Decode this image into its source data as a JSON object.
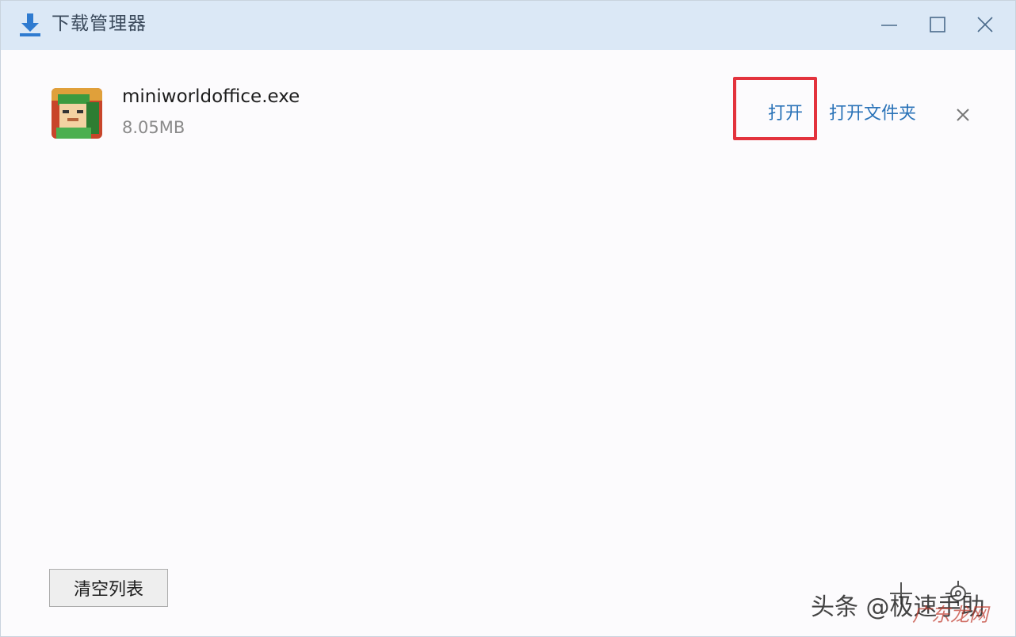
{
  "window": {
    "title": "下载管理器"
  },
  "download_item": {
    "file_name": "miniworldoffice.exe",
    "file_size": "8.05MB",
    "open_label": "打开",
    "open_folder_label": "打开文件夹"
  },
  "footer": {
    "clear_list_label": "清空列表"
  },
  "watermark": {
    "text": "头条 @极速手助",
    "sub_text": "广东龙网"
  },
  "colors": {
    "titlebar_bg": "#dbe8f6",
    "link": "#2a73b8",
    "highlight": "#e3333d",
    "download_icon": "#2f7bd0"
  },
  "icons": {
    "title": "download-icon",
    "minimize": "minimize-icon",
    "maximize": "maximize-icon",
    "close": "close-icon",
    "remove_item": "close-icon",
    "add": "plus-icon",
    "settings": "gear-icon"
  }
}
